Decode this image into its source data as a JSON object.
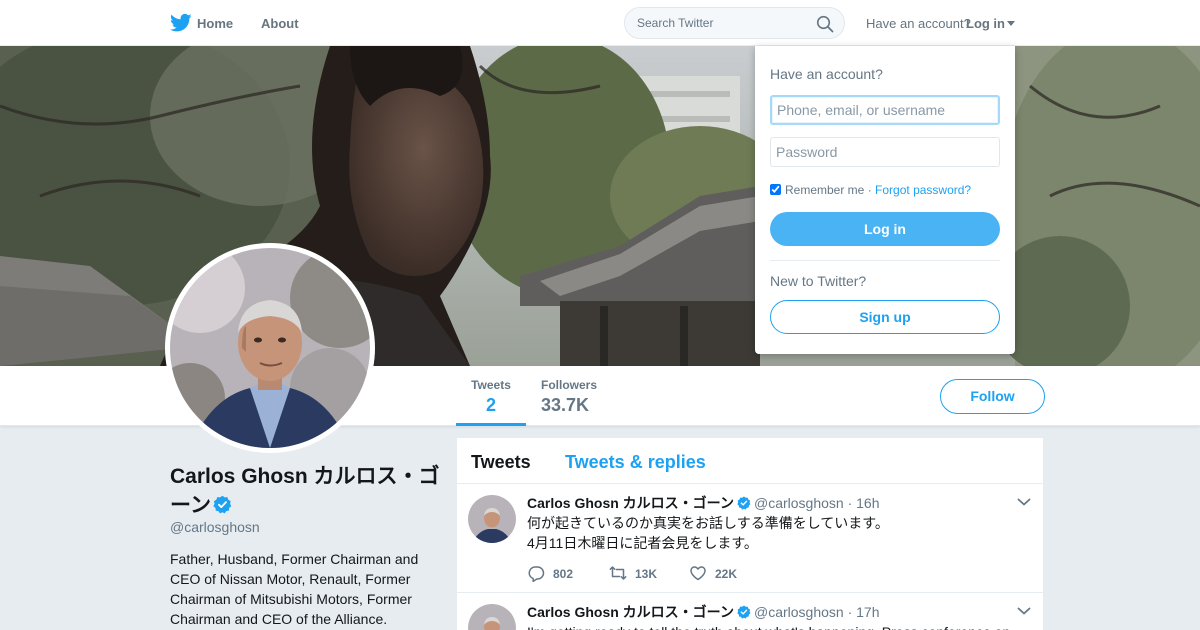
{
  "nav": {
    "home_label": "Home",
    "about_label": "About",
    "search_placeholder": "Search Twitter",
    "have_account": "Have an account?",
    "login_label": "Log in",
    "icons": [
      "twitter-bird-icon",
      "search-icon",
      "caret-down-icon"
    ]
  },
  "colors": {
    "brand": "#1da1f2",
    "button_blue": "#4ab3f4",
    "muted": "#657786",
    "background": "#e6ecf0"
  },
  "login_dropdown": {
    "title": "Have an account?",
    "username_placeholder": "Phone, email, or username",
    "password_placeholder": "Password",
    "remember_label": "Remember me",
    "separator": "·",
    "forgot_label": "Forgot password?",
    "remember_checked": true,
    "login_button": "Log in",
    "new_to_twitter": "New to Twitter?",
    "signup_button": "Sign up"
  },
  "profile_nav": {
    "stats": [
      {
        "label": "Tweets",
        "value": "2"
      },
      {
        "label": "Followers",
        "value": "33.7K"
      }
    ],
    "follow_button": "Follow"
  },
  "profile": {
    "name": "Carlos Ghosn カルロス・ゴーン",
    "verified": true,
    "handle": "@carlosghosn",
    "bio": "Father, Husband, Former Chairman and CEO of Nissan Motor, Renault, Former Chairman of Mitsubishi Motors, Former Chairman and CEO of the Alliance."
  },
  "timeline": {
    "tabs": [
      "Tweets",
      "Tweets & replies"
    ],
    "tweets": [
      {
        "name": "Carlos Ghosn カルロス・ゴーン",
        "handle": "@carlosghosn",
        "separator": "·",
        "time": "16h",
        "line1": "何が起きているのか真実をお話しする準備をしています。",
        "line2": "4月11日木曜日に記者会見をします。",
        "replies": "802",
        "retweets": "13K",
        "likes": "22K"
      },
      {
        "name": "Carlos Ghosn カルロス・ゴーン",
        "handle": "@carlosghosn",
        "separator": "·",
        "time": "17h",
        "line1": "I'm getting ready to tell the truth about what's happening.  Press conference on"
      }
    ]
  }
}
